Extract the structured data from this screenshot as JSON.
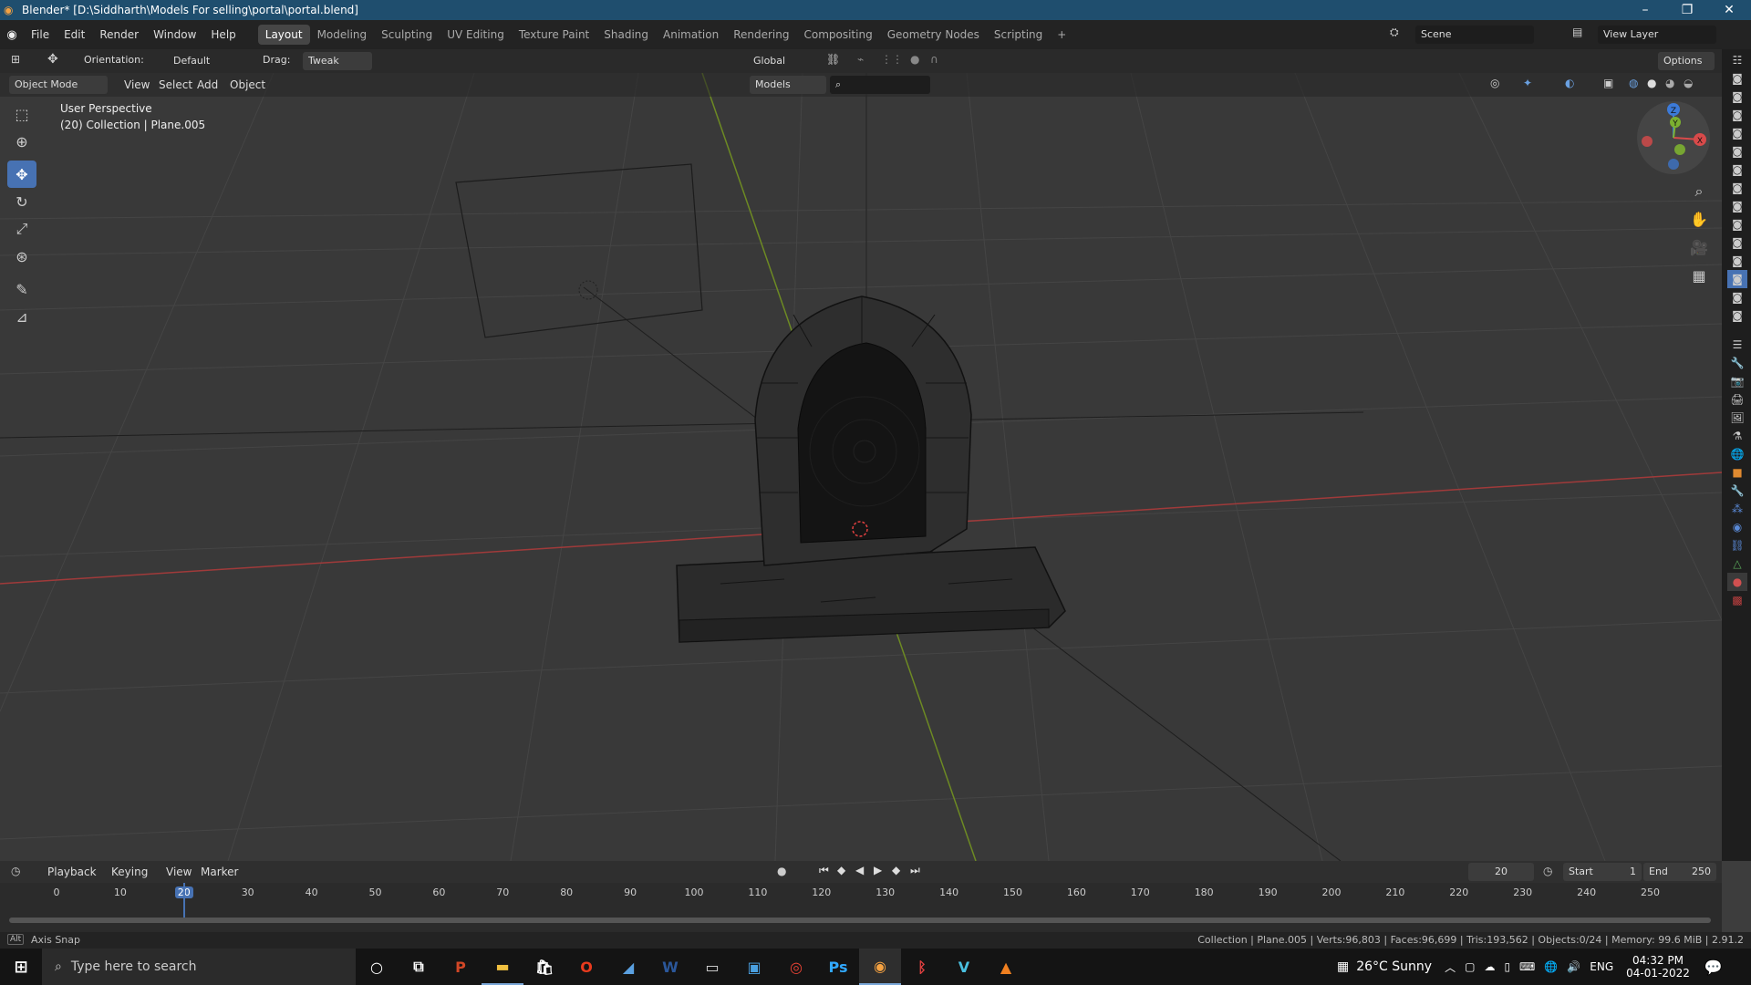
{
  "window": {
    "title": "Blender* [D:\\Siddharth\\Models For selling\\portal\\portal.blend]",
    "minimize": "–",
    "maximize": "❐",
    "close": "✕"
  },
  "menus": [
    "File",
    "Edit",
    "Render",
    "Window",
    "Help"
  ],
  "workspaces": [
    "Layout",
    "Modeling",
    "Sculpting",
    "UV Editing",
    "Texture Paint",
    "Shading",
    "Animation",
    "Rendering",
    "Compositing",
    "Geometry Nodes",
    "Scripting"
  ],
  "active_workspace": "Layout",
  "scene": {
    "label": "Scene",
    "view_layer": "View Layer"
  },
  "toolheader": {
    "orientation_label": "Orientation:",
    "orientation_value": "Default",
    "drag_label": "Drag:",
    "drag_value": "Tweak",
    "transform_orientation": "Global",
    "options_label": "Options"
  },
  "viewport_header": {
    "mode": "Object Mode",
    "menus": [
      "View",
      "Select",
      "Add",
      "Object"
    ],
    "collection_filter": "Models"
  },
  "viewport": {
    "perspective": "User Perspective",
    "collection_info": "(20) Collection | Plane.005"
  },
  "gizmo": {
    "x": "X",
    "y": "Y",
    "z": "Z"
  },
  "timeline": {
    "menus": [
      "Playback",
      "Keying",
      "View",
      "Marker"
    ],
    "current_frame": "20",
    "start_label": "Start",
    "start_value": "1",
    "end_label": "End",
    "end_value": "250",
    "ruler": [
      "0",
      "10",
      "20",
      "30",
      "40",
      "50",
      "60",
      "70",
      "80",
      "90",
      "100",
      "110",
      "120",
      "130",
      "140",
      "150",
      "160",
      "170",
      "180",
      "190",
      "200",
      "210",
      "220",
      "230",
      "240",
      "250"
    ]
  },
  "statusbar": {
    "hint_key": "Alt",
    "hint": "Axis Snap",
    "stats": "Collection | Plane.005 | Verts:96,803 | Faces:96,699 | Tris:193,562 | Objects:0/24 | Memory: 99.6 MiB | 2.91.2"
  },
  "taskbar": {
    "search_placeholder": "Type here to search",
    "weather": "26°C  Sunny",
    "lang": "ENG",
    "time": "04:32 PM",
    "date": "04-01-2022"
  },
  "colors": {
    "accent": "#4772b3",
    "x_axis": "#b03a3a",
    "y_axis": "#7a9a2a",
    "titlebar": "#1f4e6e"
  }
}
